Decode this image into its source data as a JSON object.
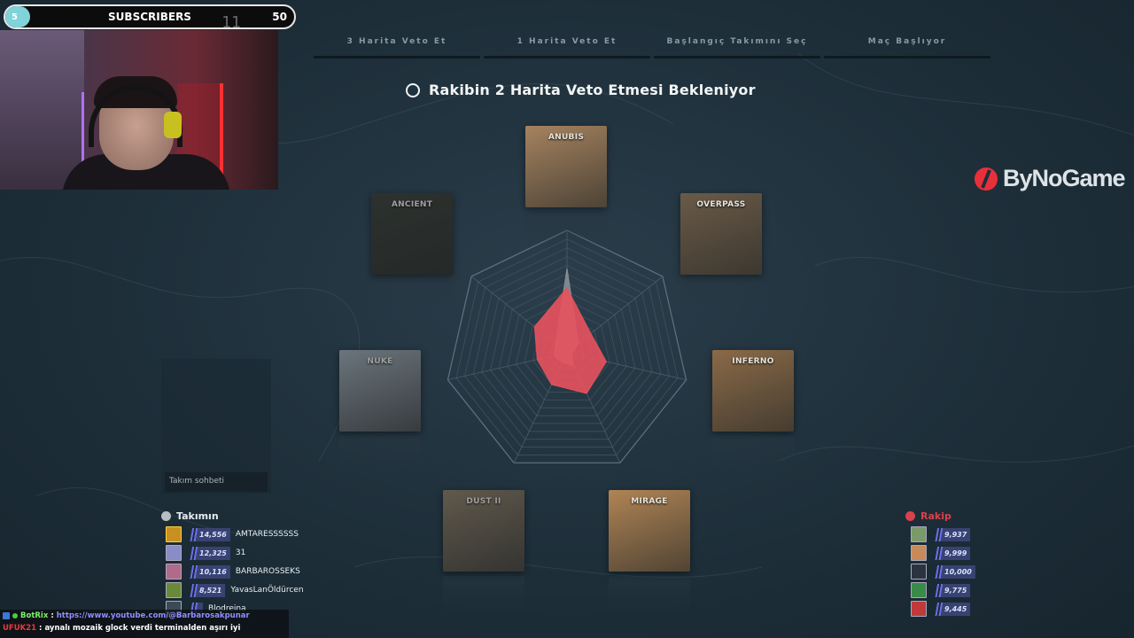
{
  "subscribers": {
    "count": "5",
    "label": "SUBSCRIBERS",
    "goal": "50",
    "current": "11"
  },
  "veto_steps": [
    "3 Harita Veto Et",
    "1 Harita Veto Et",
    "Başlangıç Takımını Seç",
    "Maç Başlıyor"
  ],
  "status_text": "Rakibin 2 Harita Veto Etmesi Bekleniyor",
  "maps": [
    {
      "name": "ANUBIS",
      "color": "#a5835f"
    },
    {
      "name": "OVERPASS",
      "color": "#6a5a48"
    },
    {
      "name": "INFERNO",
      "color": "#8a6a48"
    },
    {
      "name": "MIRAGE",
      "color": "#b08455"
    },
    {
      "name": "DUST II",
      "color": "#8a7a62"
    },
    {
      "name": "NUKE",
      "color": "#9aa4ac"
    },
    {
      "name": "ANCIENT",
      "color": "#3a3e34"
    }
  ],
  "radar": {
    "red_color": "#e8525e",
    "gray_color": "#8a9296",
    "red": [
      0.53,
      0.25,
      0.33,
      0.37,
      0.29,
      0.25,
      0.34
    ],
    "gray": [
      0.69,
      0.12,
      0.04,
      0.12,
      0.09,
      0.11,
      0.12
    ]
  },
  "sponsor": {
    "name": "ByNoGame",
    "accent": "#e8303a"
  },
  "team_chat_placeholder": "Takım sohbeti",
  "my_team": {
    "label": "Takımın",
    "players": [
      {
        "elo": "14,556",
        "name": "AMTARESSSSSS"
      },
      {
        "elo": "12,325",
        "name": "31"
      },
      {
        "elo": "10,116",
        "name": "BARBAROSSEKS"
      },
      {
        "elo": "8,521",
        "name": "YavasLanÖldürcen"
      },
      {
        "elo": "",
        "name": "Blodreina"
      }
    ]
  },
  "enemy_team": {
    "label": "Rakip",
    "players": [
      {
        "elo": "9,937"
      },
      {
        "elo": "9,999"
      },
      {
        "elo": "10,000"
      },
      {
        "elo": "9,775"
      },
      {
        "elo": "9,445"
      }
    ]
  },
  "twitch_chat": [
    {
      "user": "BotRix",
      "user_color": "#7cf06a",
      "message": "https://www.youtube.com/@Barbarosakpunar",
      "msg_color": "#8f8fff"
    },
    {
      "user": "UFUK21",
      "user_color": "#e83a3a",
      "message": "aynalı mozaik glock verdi terminalden aşırı iyi",
      "msg_color": "#ffffff"
    }
  ]
}
